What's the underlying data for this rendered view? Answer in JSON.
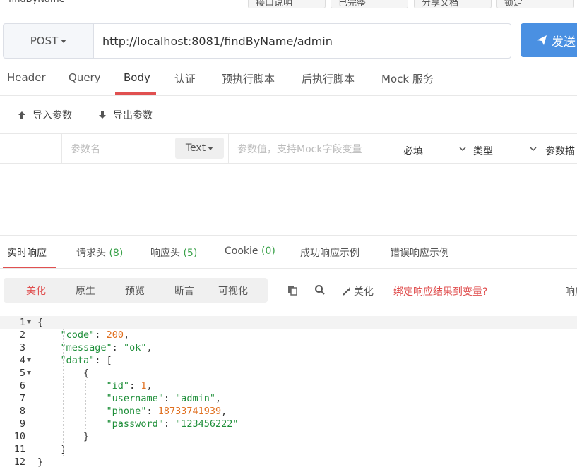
{
  "top": {
    "title": "findByName",
    "buttons": [
      "接口说明",
      "已完整",
      "分享文档",
      "锁定"
    ]
  },
  "request": {
    "method": "POST",
    "url": "http://localhost:8081/findByName/admin",
    "send_label": "发送",
    "tabs": [
      "Header",
      "Query",
      "Body",
      "认证",
      "预执行脚本",
      "后执行脚本",
      "Mock 服务"
    ],
    "active_tab": "Body"
  },
  "body": {
    "import_label": "导入参数",
    "export_label": "导出参数",
    "param_name_placeholder": "参数名",
    "type_select": "Text",
    "param_value_placeholder": "参数值，支持Mock字段变量",
    "required_select": "必填",
    "type_label": "类型",
    "desc_placeholder": "参数描"
  },
  "response": {
    "tabs": [
      {
        "label": "实时响应",
        "count": ""
      },
      {
        "label": "请求头",
        "count": "(8)"
      },
      {
        "label": "响应头",
        "count": "(5)"
      },
      {
        "label": "Cookie",
        "count": "(0)"
      },
      {
        "label": "成功响应示例",
        "count": ""
      },
      {
        "label": "错误响应示例",
        "count": ""
      }
    ],
    "format_tabs": [
      "美化",
      "原生",
      "预览",
      "断言",
      "可视化"
    ],
    "active_format": "美化",
    "beautify_label": "美化",
    "bind_link": "绑定响应结果到变量?",
    "right_label": "响应"
  },
  "code_lines": [
    {
      "n": "1",
      "text": "{"
    },
    {
      "n": "2",
      "text": "    \"code\": 200,"
    },
    {
      "n": "3",
      "text": "    \"message\": \"ok\","
    },
    {
      "n": "4",
      "text": "    \"data\": ["
    },
    {
      "n": "5",
      "text": "        {"
    },
    {
      "n": "6",
      "text": "            \"id\": 1,"
    },
    {
      "n": "7",
      "text": "            \"username\": \"admin\","
    },
    {
      "n": "8",
      "text": "            \"phone\": 18733741939,"
    },
    {
      "n": "9",
      "text": "            \"password\": \"123456222\""
    },
    {
      "n": "10",
      "text": "        }"
    },
    {
      "n": "11",
      "text": "    ]"
    },
    {
      "n": "12",
      "text": "}"
    }
  ],
  "colors": {
    "accent": "#e05050",
    "send_button": "#4a90e2",
    "json_key": "#1f8f3a",
    "json_number": "#e07020",
    "count": "#3aa14a"
  }
}
